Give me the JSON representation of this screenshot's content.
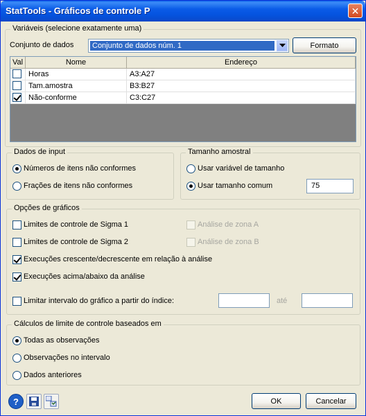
{
  "window": {
    "title": "StatTools - Gráficos de controle P",
    "close": "✕"
  },
  "variables": {
    "legend": "Variáveis (selecione exatamente uma)",
    "dataset_label": "Conjunto de dados",
    "dataset_value": "Conjunto de dados núm. 1",
    "format_button": "Formato",
    "columns": [
      "Val",
      "Nome",
      "Endereço"
    ],
    "rows": [
      {
        "checked": false,
        "name": "Horas",
        "address": "A3:A27"
      },
      {
        "checked": false,
        "name": "Tam.amostra",
        "address": "B3:B27"
      },
      {
        "checked": true,
        "name": "Não-conforme",
        "address": "C3:C27"
      }
    ]
  },
  "input_data": {
    "legend": "Dados de input",
    "options": [
      "Números de itens não conformes",
      "Frações de itens não conformes"
    ],
    "selected": 0
  },
  "sample_size": {
    "legend": "Tamanho amostral",
    "options": [
      "Usar variável de tamanho",
      "Usar tamanho comum"
    ],
    "selected": 1,
    "value": "75"
  },
  "chart_options": {
    "legend": "Opções de gráficos",
    "sigma1": "Limites de controle de Sigma 1",
    "sigma2": "Limites de controle de Sigma 2",
    "zoneA": "Análise de zona A",
    "zoneB": "Análise de zona B",
    "runs_updown": "Execuções crescente/decrescente em relação à análise",
    "runs_abovebelow": "Execuções acima/abaixo da análise",
    "limit_range": "Limitar intervalo do gráfico a partir do índice:",
    "ate": "até",
    "from_value": "",
    "to_value": ""
  },
  "limits_calc": {
    "legend": "Cálculos de limite de controle baseados em",
    "options": [
      "Todas as observações",
      "Observações no intervalo",
      "Dados anteriores"
    ],
    "selected": 0
  },
  "footer": {
    "ok": "OK",
    "cancel": "Cancelar"
  }
}
